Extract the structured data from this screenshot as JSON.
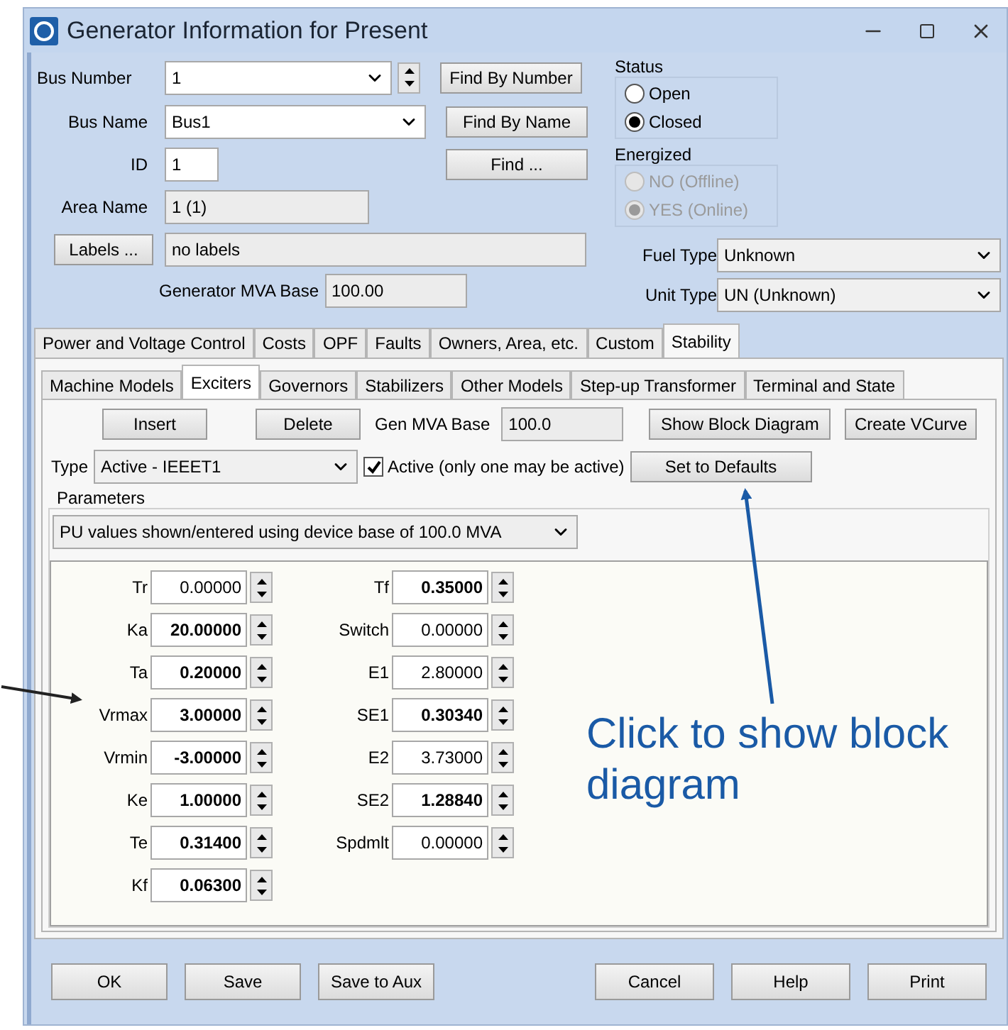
{
  "window": {
    "title": "Generator Information for Present"
  },
  "bus_number": {
    "label": "Bus Number",
    "value": "1"
  },
  "bus_name": {
    "label": "Bus Name",
    "value": "Bus1"
  },
  "id": {
    "label": "ID",
    "value": "1"
  },
  "area_name": {
    "label": "Area Name",
    "value": "1 (1)"
  },
  "labels": {
    "button": "Labels ...",
    "value": "no labels"
  },
  "generator_mva_base": {
    "label": "Generator MVA Base",
    "value": "100.00"
  },
  "find_buttons": [
    "Find By Number",
    "Find By Name",
    "Find ..."
  ],
  "status": {
    "title": "Status",
    "disabled": false,
    "options": [
      {
        "label": "Open",
        "selected": false
      },
      {
        "label": "Closed",
        "selected": true
      }
    ]
  },
  "energized": {
    "title": "Energized",
    "disabled": true,
    "options": [
      {
        "label": "NO (Offline)",
        "selected": false
      },
      {
        "label": "YES (Online)",
        "selected": true
      }
    ]
  },
  "fuel_type": {
    "label": "Fuel Type",
    "value": "Unknown"
  },
  "unit_type": {
    "label": "Unit Type",
    "value": "UN (Unknown)"
  },
  "tabs": [
    {
      "label": "Power and Voltage Control",
      "selected": false
    },
    {
      "label": "Costs",
      "selected": false
    },
    {
      "label": "OPF",
      "selected": false
    },
    {
      "label": "Faults",
      "selected": false
    },
    {
      "label": "Owners, Area, etc.",
      "selected": false
    },
    {
      "label": "Custom",
      "selected": false
    },
    {
      "label": "Stability",
      "selected": true
    }
  ],
  "subtabs": [
    {
      "label": "Machine Models",
      "selected": false
    },
    {
      "label": "Exciters",
      "selected": true
    },
    {
      "label": "Governors",
      "selected": false
    },
    {
      "label": "Stabilizers",
      "selected": false
    },
    {
      "label": "Other Models",
      "selected": false
    },
    {
      "label": "Step-up Transformer",
      "selected": false
    },
    {
      "label": "Terminal and State",
      "selected": false
    }
  ],
  "exciter": {
    "insert": "Insert",
    "delete": "Delete",
    "gen_mva_base": {
      "label": "Gen MVA Base",
      "value": "100.0"
    },
    "show_block_diagram": "Show Block Diagram",
    "create_vcurve": "Create VCurve",
    "type": {
      "label": "Type",
      "value": "Active - IEEET1"
    },
    "active": {
      "label": "Active (only one may be active)",
      "checked": true
    },
    "set_to_defaults": "Set to Defaults",
    "parameters_title": "Parameters",
    "pu_select": "PU values shown/entered using device base of 100.0 MVA",
    "parameter_columns": [
      [
        {
          "name": "Tr",
          "value": "0.00000",
          "bold": false
        },
        {
          "name": "Ka",
          "value": "20.00000",
          "bold": true
        },
        {
          "name": "Ta",
          "value": "0.20000",
          "bold": true
        },
        {
          "name": "Vrmax",
          "value": "3.00000",
          "bold": true
        },
        {
          "name": "Vrmin",
          "value": "-3.00000",
          "bold": true
        },
        {
          "name": "Ke",
          "value": "1.00000",
          "bold": true
        },
        {
          "name": "Te",
          "value": "0.31400",
          "bold": true
        },
        {
          "name": "Kf",
          "value": "0.06300",
          "bold": true
        }
      ],
      [
        {
          "name": "Tf",
          "value": "0.35000",
          "bold": true
        },
        {
          "name": "Switch",
          "value": "0.00000",
          "bold": false
        },
        {
          "name": "E1",
          "value": "2.80000",
          "bold": false
        },
        {
          "name": "SE1",
          "value": "0.30340",
          "bold": true
        },
        {
          "name": "E2",
          "value": "3.73000",
          "bold": false
        },
        {
          "name": "SE2",
          "value": "1.28840",
          "bold": true
        },
        {
          "name": "Spdmlt",
          "value": "0.00000",
          "bold": false
        }
      ]
    ]
  },
  "left_buttons": [
    "OK",
    "Save",
    "Save to Aux"
  ],
  "right_buttons": [
    "Cancel",
    "Help",
    "Print"
  ],
  "annotation": {
    "text": "Click to show block diagram"
  }
}
